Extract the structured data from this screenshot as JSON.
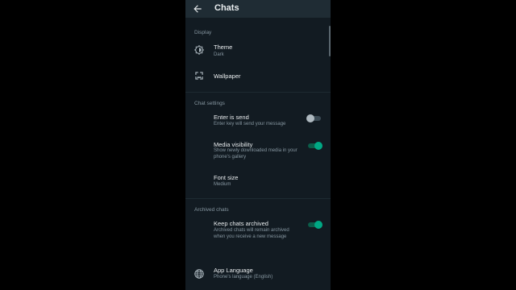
{
  "header": {
    "title": "Chats",
    "back_icon": "arrow-left-icon"
  },
  "sections": {
    "display": {
      "header": "Display",
      "theme": {
        "title": "Theme",
        "value": "Dark",
        "icon": "brightness-icon"
      },
      "wallpaper": {
        "title": "Wallpaper",
        "icon": "wallpaper-icon"
      }
    },
    "chat_settings": {
      "header": "Chat settings",
      "enter_is_send": {
        "title": "Enter is send",
        "subtitle": "Enter key will send your message",
        "enabled": false
      },
      "media_visibility": {
        "title": "Media visibility",
        "subtitle": "Show newly downloaded media in your phone's gallery",
        "enabled": true
      },
      "font_size": {
        "title": "Font size",
        "value": "Medium"
      }
    },
    "archived_chats": {
      "header": "Archived chats",
      "keep_archived": {
        "title": "Keep chats archived",
        "subtitle": "Archived chats will remain archived when you receive a new message",
        "enabled": true
      },
      "app_language": {
        "title": "App Language",
        "value": "Phone's language (English)",
        "icon": "globe-icon"
      }
    }
  },
  "colors": {
    "accent": "#00a884",
    "background": "#121b22",
    "appbar": "#1f2c34",
    "text_primary": "#e9edef",
    "text_secondary": "#8696a0"
  }
}
